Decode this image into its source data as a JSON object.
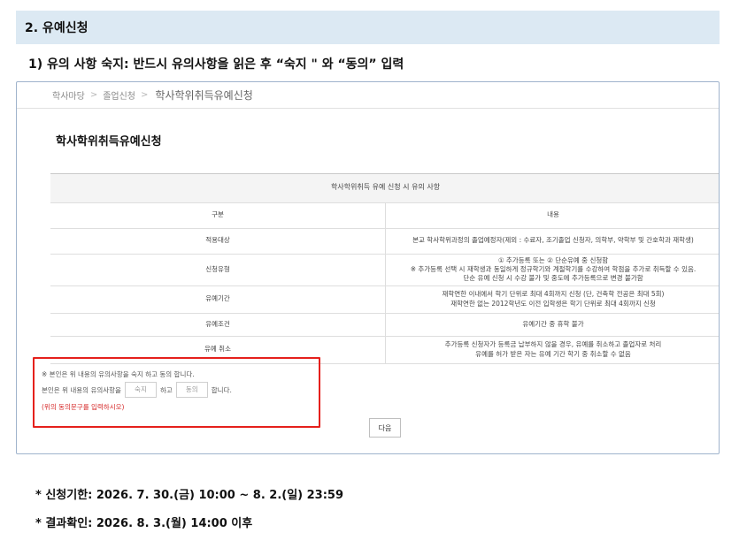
{
  "section": {
    "title": "2. 유예신청"
  },
  "step": {
    "title": "1) 유의 사항 숙지: 반드시 유의사항을 읽은 후 “숙지 \" 와 “동의” 입력"
  },
  "breadcrumb": {
    "items": [
      "학사마당",
      "졸업신청"
    ],
    "current": "학사학위취득유예신청",
    "separator": ">"
  },
  "page_title": "학사학위취득유예신청",
  "notice_table": {
    "caption": "학사학위취득 유예 신청 시 유의 사항",
    "headers": [
      "구분",
      "내용"
    ],
    "rows": [
      {
        "label": "적용대상",
        "lines": [
          "본교 학사학위과정의 졸업예정자(제외 : 수료자, 조기졸업 신청자, 의학부, 약학부 및 간호학과 재학생)"
        ]
      },
      {
        "label": "신청유형",
        "lines": [
          "① 추가등록 또는 ② 단순유예 중 신청함",
          "※ 추가등록 선택 시 재학생과 동일하게 정규학기와 계절학기를 수강하여 학점을 추가로 취득할 수 있음.",
          "단순 유예 신청 시 수강 불가 및 중도에 추가등록으로 변경 불가함"
        ]
      },
      {
        "label": "유예기간",
        "lines": [
          "재학연한 이내에서 학기 단위로 최대 4회까지 신청 (단, 건축학 전공은 최대 5회)",
          "재학연한 없는 2012학년도 이전 입학생은 학기 단위로 최대 4회까지 신청"
        ]
      },
      {
        "label": "유예조건",
        "lines": [
          "유예기간 중 휴학 불가"
        ]
      },
      {
        "label": "유예 취소",
        "lines": [
          "추가등록 신청자가 등록금 납부하지 않을 경우, 유예를 취소하고 졸업자로 처리",
          "유예를 허가 받은 자는 유예 기간 학기 중 취소할 수 없음"
        ]
      }
    ]
  },
  "agreement": {
    "line1": "※ 본인은 위 내용의 유의사항을 숙지 하고 동의 합니다.",
    "line2_prefix": "본인은 위 내용의 유의사항을",
    "input1_placeholder": "숙지",
    "line2_middle": "하고",
    "input2_placeholder": "동의",
    "line2_suffix": "합니다.",
    "hint": "(위의 동의문구를 입력하시오)"
  },
  "next_button": {
    "label": "다음"
  },
  "notices": [
    "* 신청기한: 2026. 7. 30.(금) 10:00 ~ 8. 2.(일) 23:59",
    "* 결과확인: 2026. 8. 3.(월) 14:00 이후"
  ],
  "colors": {
    "section_bg": "#dce9f3",
    "highlight_border": "#e5201c",
    "hint_text": "#d62828",
    "frame_border": "#9fb3cc"
  }
}
